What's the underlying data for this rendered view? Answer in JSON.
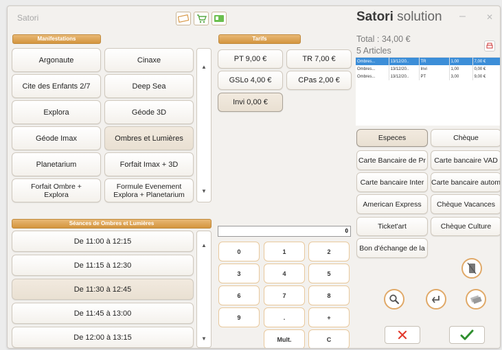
{
  "titlebar": {
    "app_name": "Satori",
    "brand_bold": "Satori",
    "brand_rest": " solution",
    "minimize": "–",
    "close": "✕"
  },
  "manifestations": {
    "header": "Manifestations",
    "items": [
      {
        "label": "Argonaute"
      },
      {
        "label": "Cinaxe"
      },
      {
        "label": "Cite des Enfants 2/7"
      },
      {
        "label": "Deep Sea"
      },
      {
        "label": "Explora"
      },
      {
        "label": "Géode 3D"
      },
      {
        "label": "Géode Imax"
      },
      {
        "label": "Ombres et Lumières"
      },
      {
        "label": "Planetarium"
      },
      {
        "label": "Forfait Imax + 3D"
      },
      {
        "label": "Forfait Ombre + Explora"
      },
      {
        "label": "Formule Evenement Explora + Planetarium"
      }
    ],
    "selected": "Ombres et Lumières"
  },
  "tarifs": {
    "header": "Tarifs",
    "items": [
      {
        "label": "PT 9,00 €"
      },
      {
        "label": "TR 7,00 €"
      },
      {
        "label": "GSLo 4,00 €"
      },
      {
        "label": "CPas 2,00 €"
      },
      {
        "label": "Invi 0,00 €"
      }
    ]
  },
  "seances": {
    "header": "Séances de Ombres et Lumières",
    "items": [
      {
        "label": "De 11:00 à 12:15"
      },
      {
        "label": "De 11:15 à 12:30"
      },
      {
        "label": "De 11:30 à 12:45"
      },
      {
        "label": "De 11:45 à 13:00"
      },
      {
        "label": "De 12:00 à 13:15"
      }
    ],
    "selected": "De 11:30 à 12:45"
  },
  "keypad": {
    "display_value": "0",
    "keys": [
      "0",
      "1",
      "2",
      "3",
      "4",
      "5",
      "6",
      "7",
      "8",
      "9",
      ".",
      "+",
      "Mult.",
      "C"
    ]
  },
  "cart": {
    "total": "Total : 34,00 €",
    "articles": "5 Articles",
    "rows": [
      {
        "name": "Ombres...",
        "date": "13/12/20..",
        "tarif": "TR",
        "qty": "1,00",
        "price": "7,00 €"
      },
      {
        "name": "Ombres...",
        "date": "13/12/20..",
        "tarif": "Invi",
        "qty": "1,00",
        "price": "0,00 €"
      },
      {
        "name": "Ombres...",
        "date": "13/12/20..",
        "tarif": "PT",
        "qty": "3,00",
        "price": "9,00 €"
      }
    ]
  },
  "payments": [
    {
      "label": "Especes"
    },
    {
      "label": "Chèque"
    },
    {
      "label": "Carte Bancaire de Pr"
    },
    {
      "label": "Carte bancaire VAD"
    },
    {
      "label": "Carte bancaire Inter"
    },
    {
      "label": "Carte bancaire autom"
    },
    {
      "label": "American Express"
    },
    {
      "label": "Chèque Vacances"
    },
    {
      "label": "Ticket'art"
    },
    {
      "label": "Chèque Culture"
    },
    {
      "label": "Bon d'échange de la"
    }
  ],
  "scroll_up": "▲",
  "scroll_down": "▼",
  "colors": {
    "accent": "#d9a157",
    "selected": "#ede4d7",
    "cart_highlight": "#3c8ed8",
    "cancel": "#e23b2e",
    "confirm": "#2f8f2f"
  }
}
